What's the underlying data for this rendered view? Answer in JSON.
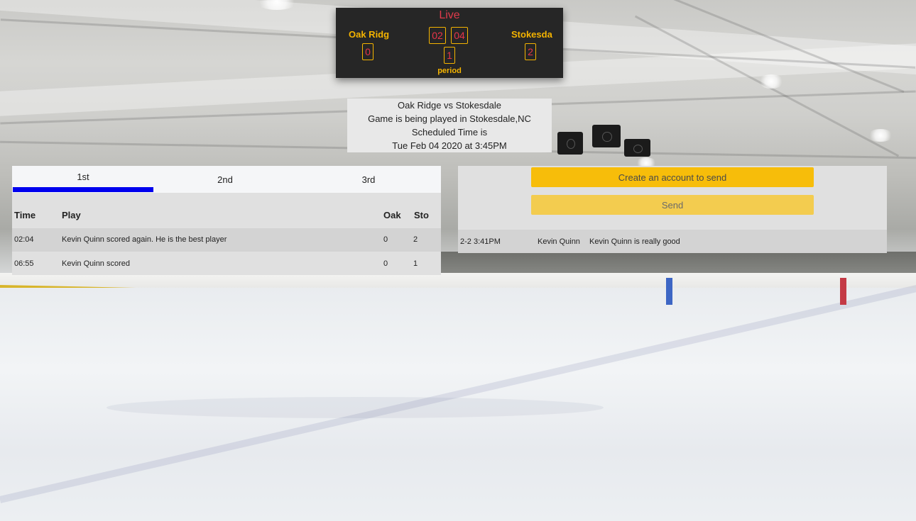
{
  "scoreboard": {
    "status": "Live",
    "home_team": "Oak Ridg",
    "away_team": "Stokesda",
    "home_score": "0",
    "away_score": "2",
    "clock_minutes": "02",
    "clock_seconds": "04",
    "period": "1",
    "period_label": "period"
  },
  "game_info": {
    "matchup": "Oak Ridge vs Stokesdale",
    "location": "Game is being played in Stokesdale,NC",
    "scheduled_label": "Scheduled Time is",
    "scheduled_time": "Tue Feb 04 2020 at 3:45PM"
  },
  "play_by_play": {
    "tabs": [
      {
        "label": "1st",
        "active": true
      },
      {
        "label": "2nd",
        "active": false
      },
      {
        "label": "3rd",
        "active": false
      }
    ],
    "columns": {
      "time": "Time",
      "play": "Play",
      "home": "Oak",
      "away": "Sto"
    },
    "rows": [
      {
        "time": "02:04",
        "play": "Kevin Quinn scored again. He is the best player",
        "home": "0",
        "away": "2"
      },
      {
        "time": "06:55",
        "play": "Kevin Quinn scored",
        "home": "0",
        "away": "1"
      }
    ]
  },
  "chat": {
    "account_button": "Create an account to send",
    "send_button": "Send",
    "messages": [
      {
        "time": "2-2 3:41PM",
        "user": "Kevin Quinn",
        "text": "Kevin Quinn is really good"
      }
    ]
  },
  "colors": {
    "accent_yellow": "#f5b400",
    "score_red": "#e8344a",
    "tab_indicator": "#0000ee",
    "scoreboard_bg": "#262626"
  }
}
